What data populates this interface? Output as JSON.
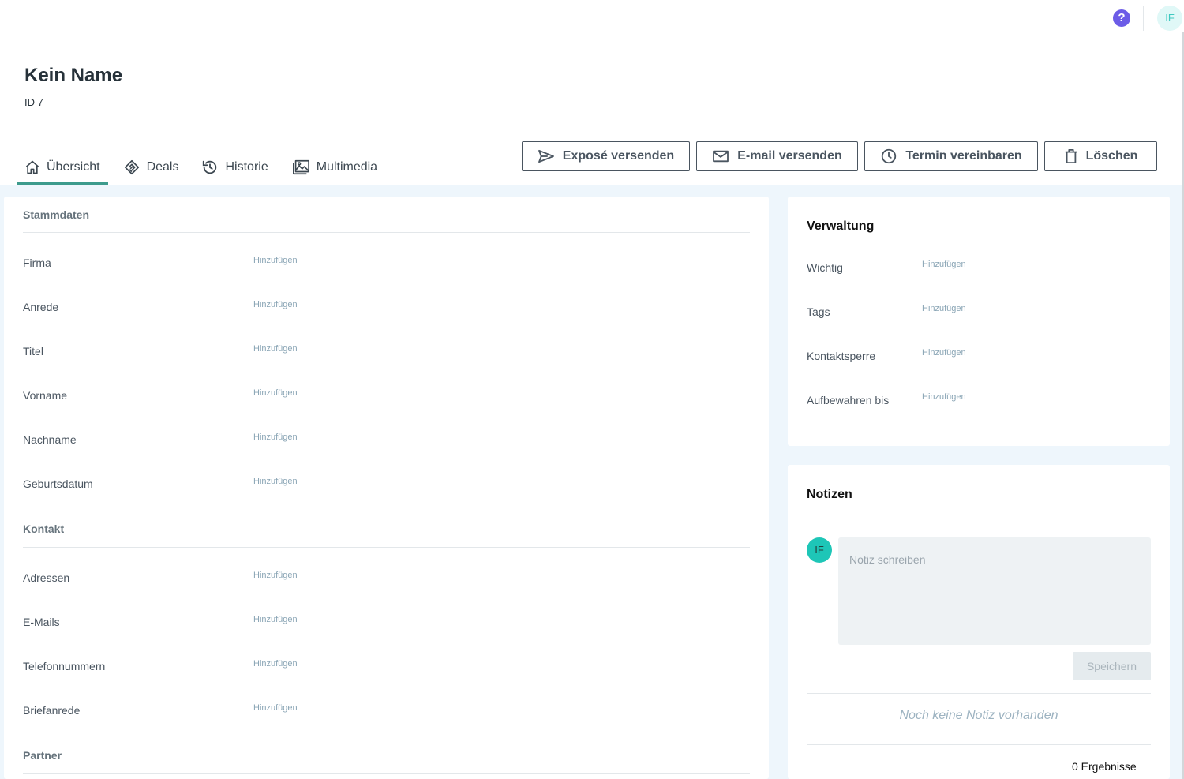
{
  "header": {
    "help_icon": "question-circle-icon",
    "avatar_initials": "IF"
  },
  "record": {
    "title": "Kein Name",
    "id_label": "ID 7"
  },
  "tabs": [
    {
      "label": "Übersicht",
      "icon": "home-icon",
      "active": true
    },
    {
      "label": "Deals",
      "icon": "handshake-icon",
      "active": false
    },
    {
      "label": "Historie",
      "icon": "history-icon",
      "active": false
    },
    {
      "label": "Multimedia",
      "icon": "images-icon",
      "active": false
    }
  ],
  "actions": [
    {
      "label": "Exposé versenden",
      "icon": "send-icon"
    },
    {
      "label": "E-mail versenden",
      "icon": "mail-icon"
    },
    {
      "label": "Termin vereinbaren",
      "icon": "clock-icon"
    },
    {
      "label": "Löschen",
      "icon": "trash-icon"
    }
  ],
  "stammdaten": {
    "heading": "Stammdaten",
    "add_label": "Hinzufügen",
    "fields": [
      "Firma",
      "Anrede",
      "Titel",
      "Vorname",
      "Nachname",
      "Geburtsdatum"
    ]
  },
  "kontakt": {
    "heading": "Kontakt",
    "add_label": "Hinzufügen",
    "fields": [
      "Adressen",
      "E-Mails",
      "Telefonnummern",
      "Briefanrede"
    ]
  },
  "partner": {
    "heading": "Partner"
  },
  "verwaltung": {
    "title": "Verwaltung",
    "add_label": "Hinzufügen",
    "fields": [
      "Wichtig",
      "Tags",
      "Kontaktsperre",
      "Aufbewahren bis"
    ]
  },
  "notizen": {
    "title": "Notizen",
    "avatar_initials": "IF",
    "placeholder": "Notiz schreiben",
    "save_label": "Speichern",
    "empty_text": "Noch keine Notiz vorhanden",
    "results_text": "0 Ergebnisse"
  },
  "colors": {
    "accent": "#3d9b8d",
    "help": "#6c5ce7",
    "avatar": "#1ec6b7",
    "link": "#8aa5b5",
    "background": "#eef6fc"
  }
}
